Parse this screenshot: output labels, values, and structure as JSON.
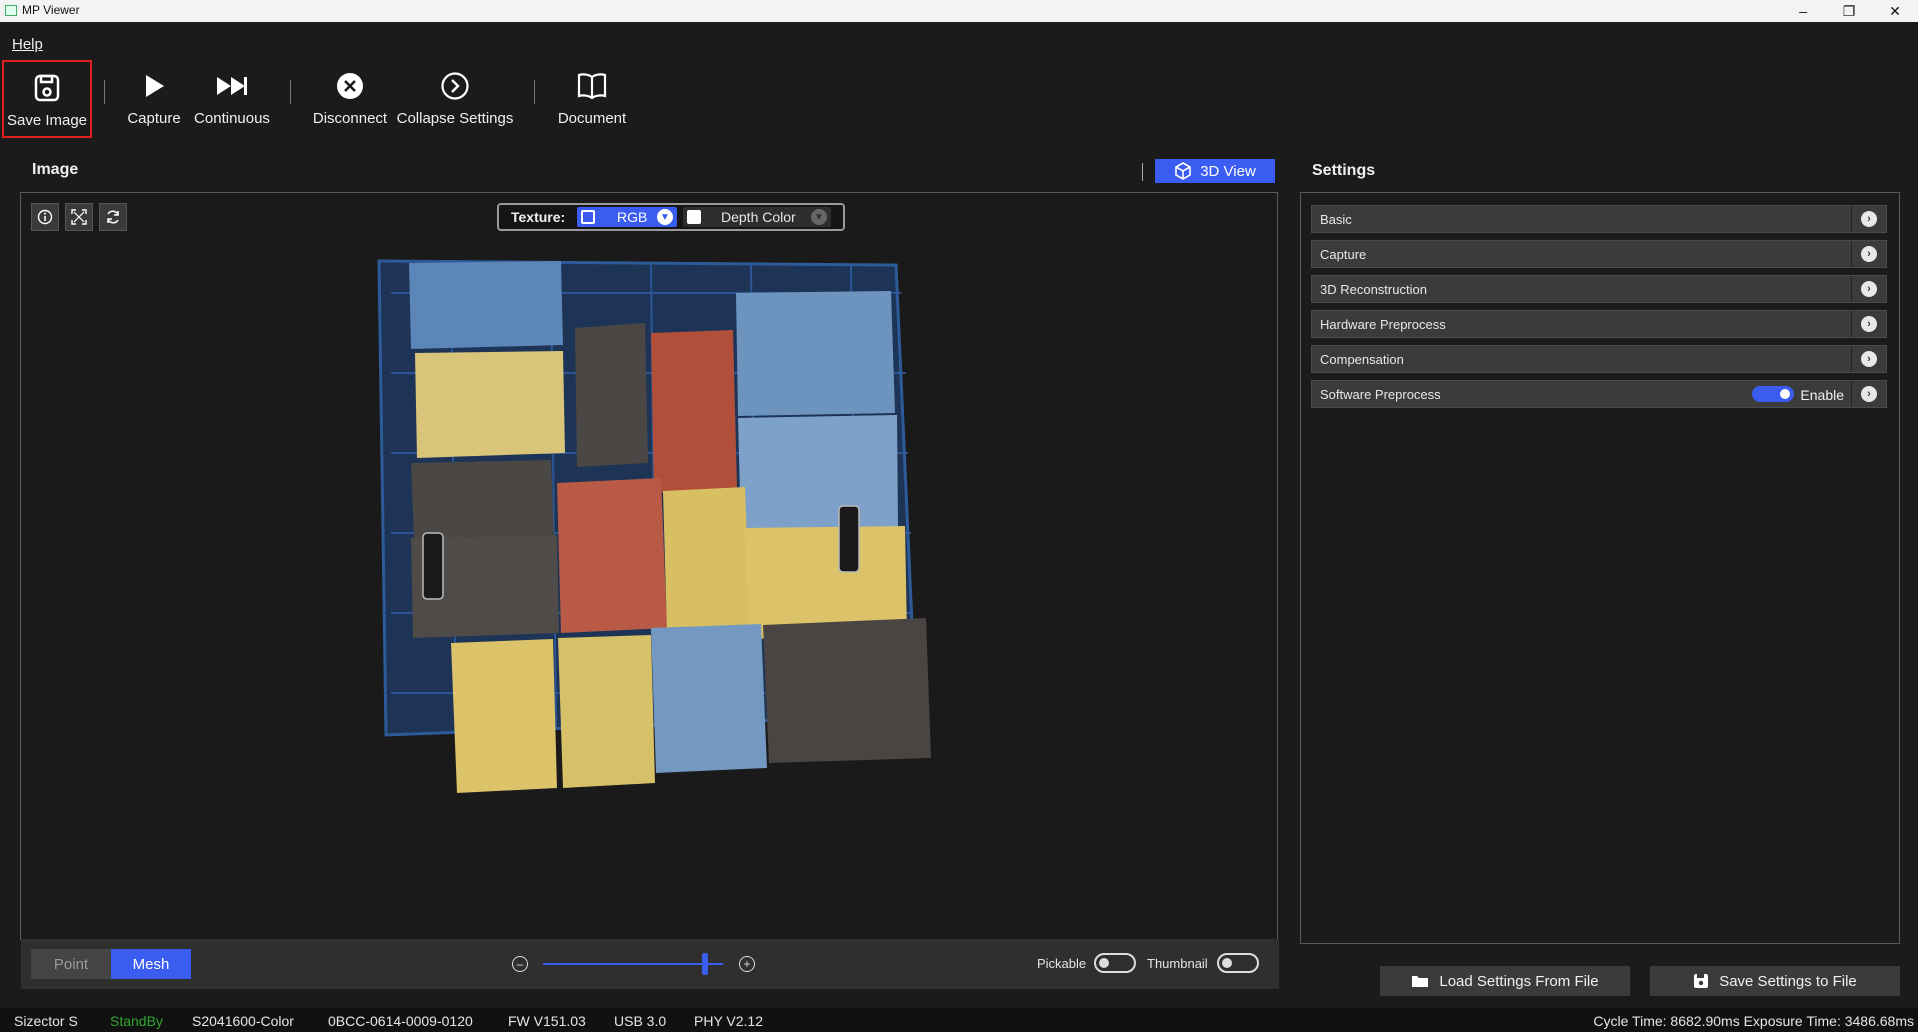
{
  "window": {
    "title": "MP Viewer"
  },
  "menu": {
    "help": "Help"
  },
  "toolbar": {
    "save_image": "Save Image",
    "capture": "Capture",
    "continuous": "Continuous",
    "disconnect": "Disconnect",
    "collapse_settings": "Collapse Settings",
    "document": "Document"
  },
  "image_panel": {
    "title": "Image",
    "view_toggle": "3D View",
    "texture": {
      "label": "Texture:",
      "option1": "RGB",
      "option2": "Depth Color"
    },
    "modes": {
      "point": "Point",
      "mesh": "Mesh"
    },
    "zoom_level": 0.9,
    "pickable": "Pickable",
    "thumbnail": "Thumbnail"
  },
  "settings": {
    "title": "Settings",
    "rows": [
      {
        "label": "Basic"
      },
      {
        "label": "Capture"
      },
      {
        "label": "3D Reconstruction"
      },
      {
        "label": "Hardware Preprocess"
      },
      {
        "label": "Compensation"
      },
      {
        "label": "Software Preprocess",
        "toggle_label": "Enable"
      }
    ],
    "load_button": "Load Settings From File",
    "save_button": "Save Settings to File"
  },
  "status": {
    "model": "Sizector S",
    "state": "StandBy",
    "serial": "S2041600-Color",
    "id": "0BCC-0614-0009-0120",
    "fw": "FW V151.03",
    "usb": "USB 3.0",
    "phy": "PHY V2.12",
    "timing": "Cycle Time: 8682.90ms Exposure Time: 3486.68ms"
  },
  "colors": {
    "accent": "#3a5cf0",
    "highlight_border": "#e02020",
    "standby": "#2fa82f"
  }
}
